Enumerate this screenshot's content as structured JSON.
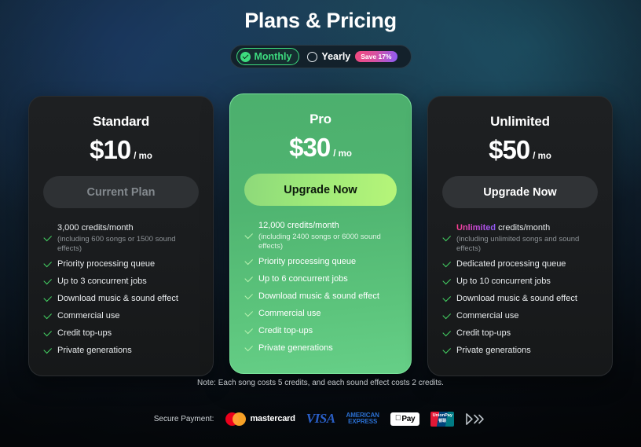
{
  "header": {
    "title": "Plans & Pricing"
  },
  "billing_toggle": {
    "monthly": {
      "label": "Monthly",
      "selected": true,
      "icon": "check-circle-icon"
    },
    "yearly": {
      "label": "Yearly",
      "selected": false,
      "icon": "radio-empty-icon",
      "badge": "Save 17%"
    }
  },
  "plans": [
    {
      "id": "standard",
      "name": "Standard",
      "price": "$10",
      "period": "/ mo",
      "cta": "Current Plan",
      "cta_state": "disabled",
      "highlighted": false,
      "features": [
        {
          "main": "3,000 credits/month",
          "sub": "(including 600 songs or 1500 sound effects)"
        },
        {
          "main": "Priority processing queue"
        },
        {
          "main": "Up to 3 concurrent jobs"
        },
        {
          "main": "Download music & sound effect"
        },
        {
          "main": "Commercial use"
        },
        {
          "main": "Credit top-ups"
        },
        {
          "main": "Private generations"
        }
      ]
    },
    {
      "id": "pro",
      "name": "Pro",
      "price": "$30",
      "period": "/ mo",
      "cta": "Upgrade Now",
      "cta_state": "primary",
      "highlighted": true,
      "features": [
        {
          "main": "12,000 credits/month",
          "sub": "(including 2400 songs or 6000 sound effects)"
        },
        {
          "main": "Priority processing queue"
        },
        {
          "main": "Up to 6 concurrent jobs"
        },
        {
          "main": "Download music & sound effect"
        },
        {
          "main": "Commercial use"
        },
        {
          "main": "Credit top-ups"
        },
        {
          "main": "Private generations"
        }
      ]
    },
    {
      "id": "unlimited",
      "name": "Unlimited",
      "price": "$50",
      "period": "/ mo",
      "cta": "Upgrade Now",
      "cta_state": "secondary",
      "highlighted": false,
      "features": [
        {
          "main_gradient_word": "Unlimited",
          "main_rest": " credits/month",
          "sub": "(including unlimited songs and sound effects)"
        },
        {
          "main": "Dedicated processing queue"
        },
        {
          "main": "Up to 10 concurrent jobs"
        },
        {
          "main": "Download music & sound effect"
        },
        {
          "main": "Commercial use"
        },
        {
          "main": "Credit top-ups"
        },
        {
          "main": "Private generations"
        }
      ]
    }
  ],
  "footer": {
    "note": "Note: Each song costs 5 credits, and each sound effect costs 2 credits.",
    "secure_payment_label": "Secure Payment:",
    "methods": [
      {
        "id": "mastercard",
        "name": "mastercard"
      },
      {
        "id": "visa",
        "name": "VISA"
      },
      {
        "id": "amex",
        "line1": "AMERICAN",
        "line2": "EXPRESS"
      },
      {
        "id": "applepay",
        "name": "Pay"
      },
      {
        "id": "unionpay",
        "line1": "UnionPay",
        "line2": "银联"
      },
      {
        "id": "chevron-brand",
        "name": ""
      }
    ]
  },
  "colors": {
    "accent_green": "#3ddc7f",
    "pro_card": "#50b571",
    "lime_button": "#9ce879",
    "badge_gradient_start": "#f2497e",
    "badge_gradient_end": "#8b5cf6",
    "unlimited_gradient_start": "#ff3d8b",
    "unlimited_gradient_end": "#8b5cf6",
    "card_dark": "#1a1c1e"
  }
}
